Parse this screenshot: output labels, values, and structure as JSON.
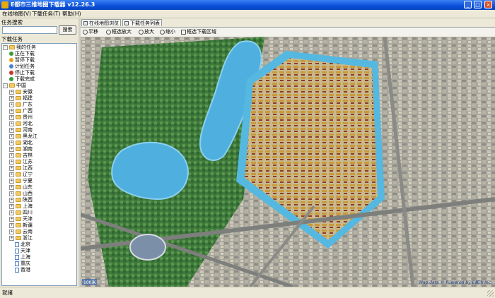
{
  "window": {
    "title": "E都市三维地图下载器 v12.26.3"
  },
  "menu": [
    "在线地图(V)",
    "下载任务(T)",
    "帮助(H)"
  ],
  "search": {
    "section_title": "任务搜索",
    "placeholder": "",
    "button": "搜索"
  },
  "tasks": {
    "section_title": "下载任务",
    "my_tasks": "我的任务",
    "items": [
      {
        "label": "正在下载",
        "color": "#3b9d2f"
      },
      {
        "label": "暂停下载",
        "color": "#e0a21b"
      },
      {
        "label": "计划任务",
        "color": "#4a7fd0"
      },
      {
        "label": "停止下载",
        "color": "#c7352b"
      },
      {
        "label": "下载完成",
        "color": "#2e9c3a"
      }
    ]
  },
  "regions": {
    "root": "中国",
    "provinces": [
      "安徽",
      "福建",
      "广东",
      "广西",
      "贵州",
      "河北",
      "河南",
      "黑龙江",
      "湖北",
      "湖南",
      "吉林",
      "江苏",
      "江西",
      "辽宁",
      "宁夏",
      "山东",
      "山西",
      "陕西",
      "上海",
      "四川",
      "天津",
      "新疆",
      "云南",
      "浙江"
    ],
    "cities": [
      "北京",
      "天津",
      "上海",
      "重庆",
      "香港"
    ]
  },
  "tabs": [
    "在线地图浏览",
    "下载任务列表"
  ],
  "toolbar": [
    "平移",
    "框选放大",
    "放大",
    "缩小",
    "框选下载区域"
  ],
  "map": {
    "scale": "100米",
    "credit": "Map data © Powered by E都市 Inc."
  },
  "status": "就绪",
  "colors": {
    "title_bar": "#0a4fd8",
    "moat": "#55b8e0",
    "lake": "#4fb0df"
  }
}
